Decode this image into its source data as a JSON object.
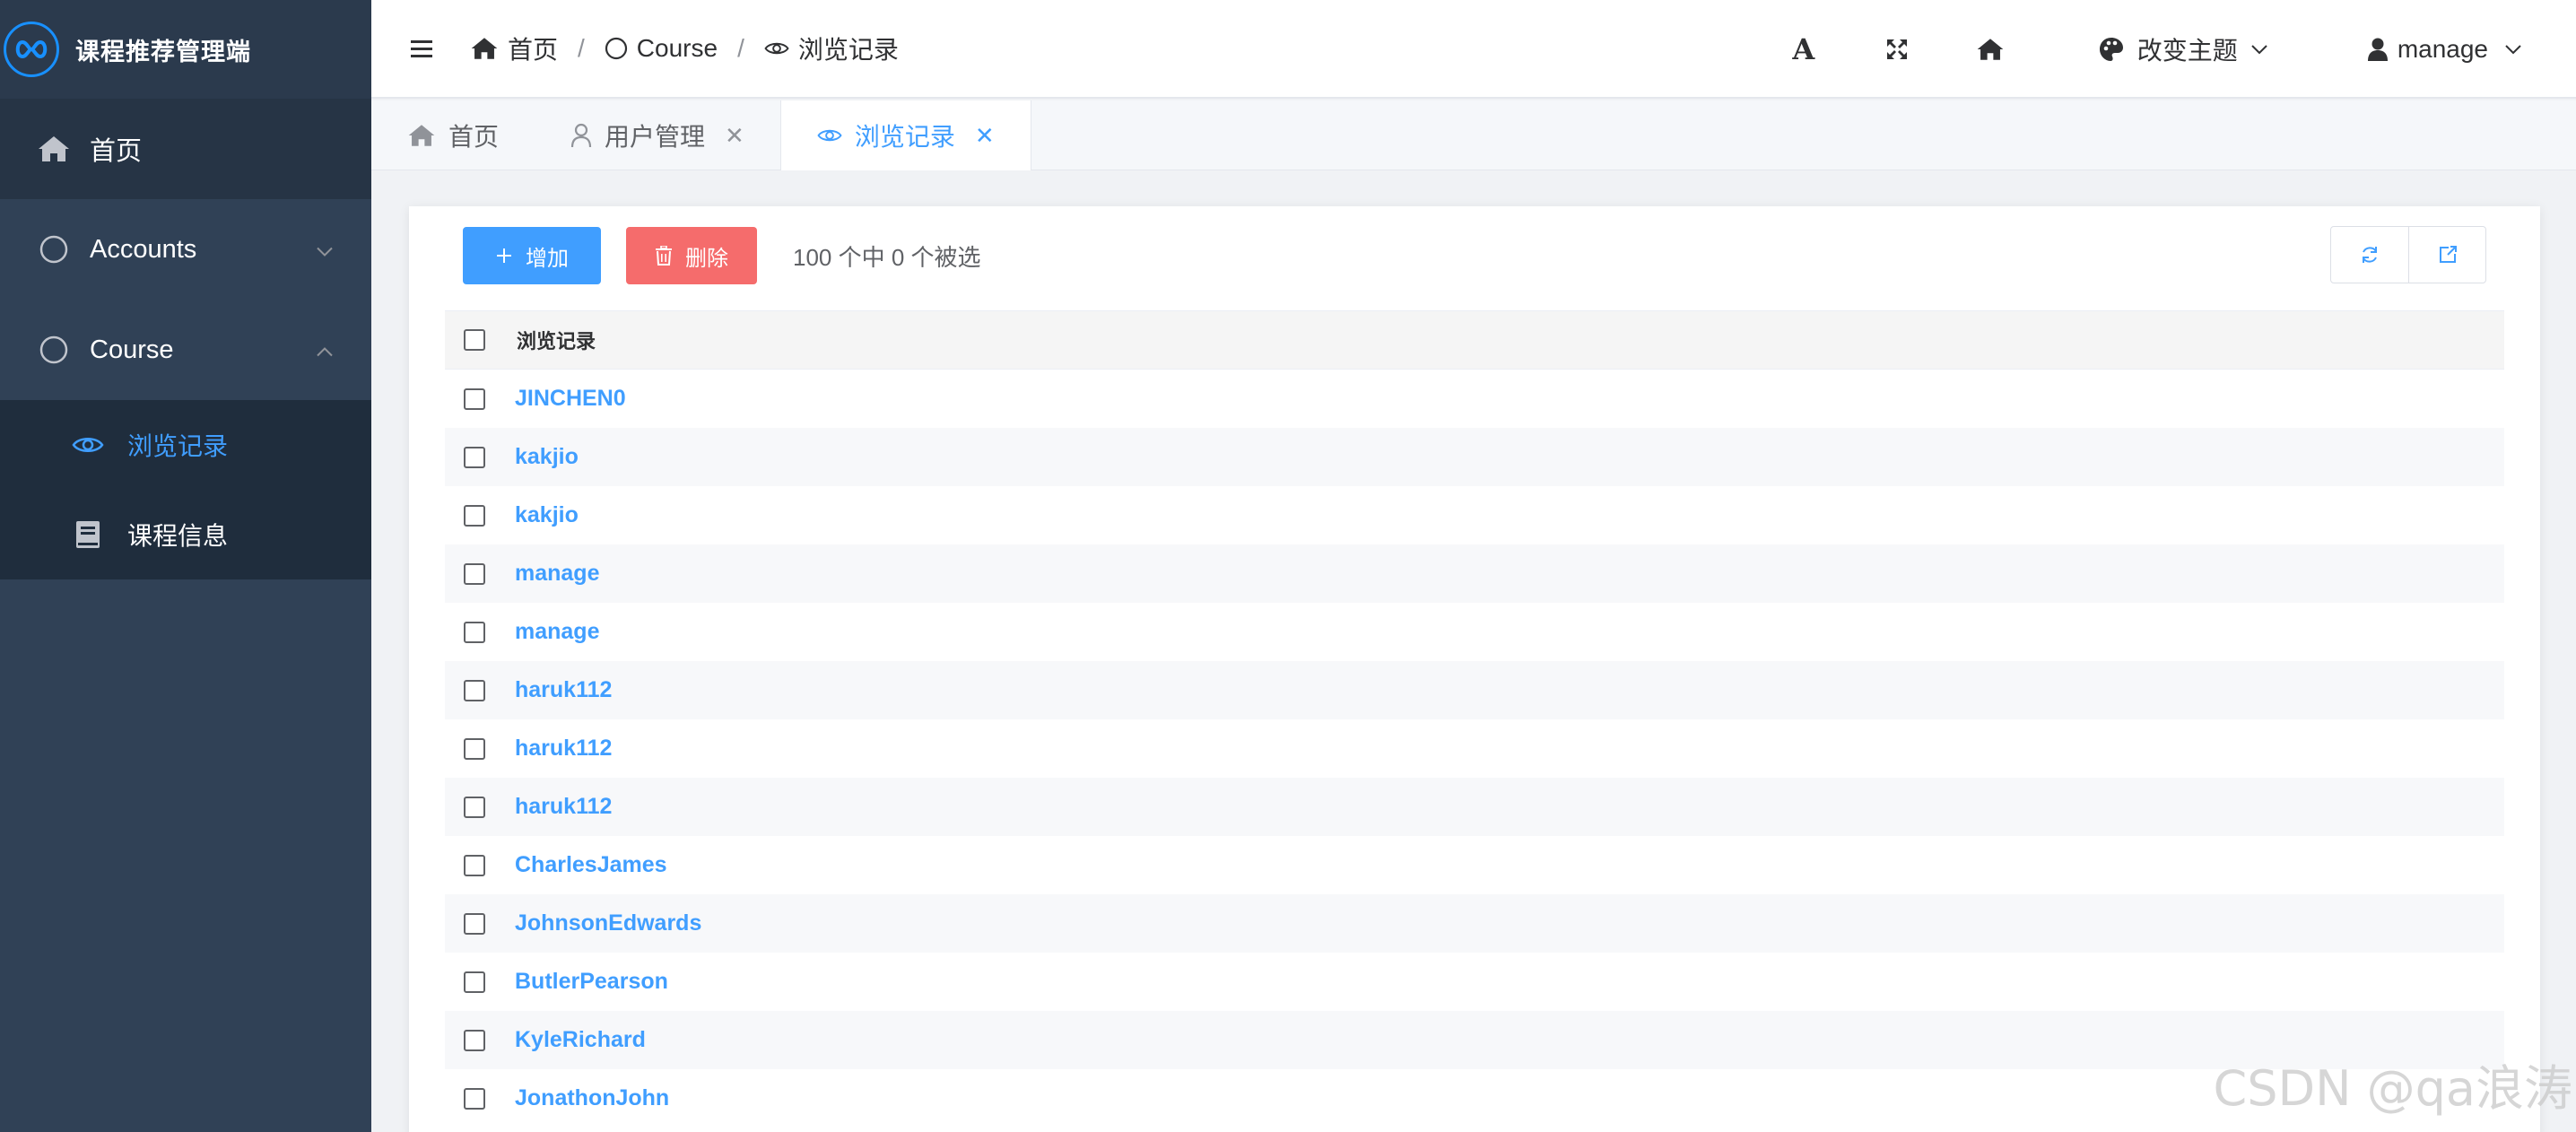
{
  "brand": {
    "title": "课程推荐管理端"
  },
  "sidebar": {
    "items": [
      {
        "label": "首页",
        "icon": "home-icon"
      },
      {
        "label": "Accounts",
        "icon": "circle-icon",
        "expanded": false
      },
      {
        "label": "Course",
        "icon": "circle-icon",
        "expanded": true
      }
    ],
    "course_children": [
      {
        "label": "浏览记录",
        "icon": "eye-icon",
        "active": true
      },
      {
        "label": "课程信息",
        "icon": "book-icon",
        "active": false
      }
    ]
  },
  "header": {
    "breadcrumb": [
      "首页",
      "Course",
      "浏览记录"
    ],
    "theme_label": "改变主题",
    "user_label": "manage"
  },
  "tags": [
    {
      "label": "首页",
      "closable": false,
      "active": false
    },
    {
      "label": "用户管理",
      "closable": true,
      "active": false
    },
    {
      "label": "浏览记录",
      "closable": true,
      "active": true
    }
  ],
  "toolbar": {
    "add_label": "增加",
    "delete_label": "删除",
    "selection_info": "100 个中 0 个被选"
  },
  "table": {
    "column": "浏览记录",
    "rows": [
      "JINCHEN0",
      "kakjio",
      "kakjio",
      "manage",
      "manage",
      "haruk112",
      "haruk112",
      "haruk112",
      "CharlesJames",
      "JohnsonEdwards",
      "ButlerPearson",
      "KyleRichard",
      "JonathonJohn"
    ]
  },
  "watermark": "CSDN @qa浪涛",
  "colors": {
    "primary": "#409eff",
    "danger": "#f56c6c",
    "sidebar": "#304156"
  }
}
